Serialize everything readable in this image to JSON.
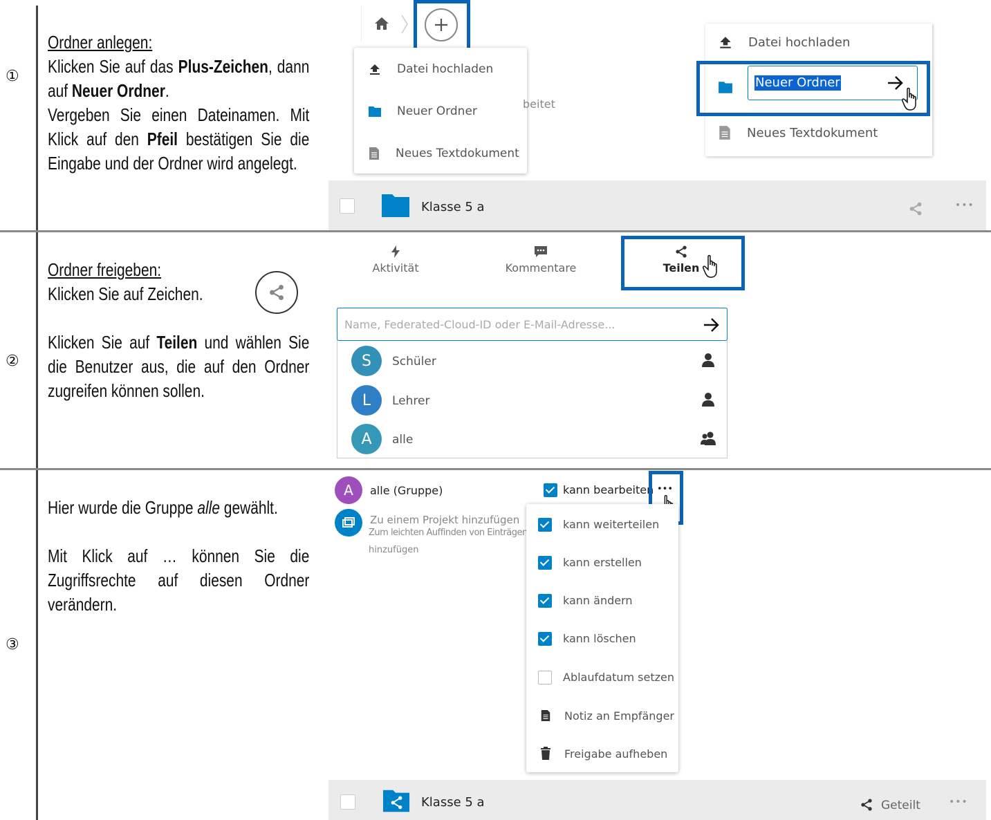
{
  "rows": [
    {
      "number": "①",
      "heading": "Ordner anlegen:",
      "text_parts": [
        {
          "t": "Klicken Sie auf das ",
          "b": false
        },
        {
          "t": "Plus-Zeichen",
          "b": true
        },
        {
          "t": ", dann auf ",
          "b": false
        },
        {
          "t": "Neuer Ordner",
          "b": true
        },
        {
          "t": ".",
          "b": false
        }
      ],
      "text2_parts": [
        {
          "t": "Vergeben Sie einen Dateinamen. Mit Klick auf den ",
          "b": false
        },
        {
          "t": "Pfeil",
          "b": true
        },
        {
          "t": " bestätigen Sie die Eingabe und der Ordner wird angelegt.",
          "b": false
        }
      ]
    },
    {
      "number": "②",
      "heading": "Ordner freigeben:",
      "line1": "Klicken Sie auf Zeichen.",
      "text_parts": [
        {
          "t": "Klicken Sie auf ",
          "b": false
        },
        {
          "t": "Teilen",
          "b": true
        },
        {
          "t": " und wählen Sie die Benutzer aus, die auf den Ordner zugreifen können sollen.",
          "b": false
        }
      ]
    },
    {
      "number": "③",
      "line1_parts": [
        {
          "t": "Hier wurde die Gruppe ",
          "i": false
        },
        {
          "t": "alle",
          "i": true
        },
        {
          "t": " gewählt.",
          "i": false
        }
      ],
      "text": "Mit Klick auf … können Sie die Zugriffsrechte auf diesen Ordner verändern."
    }
  ],
  "screen1": {
    "menu_left": {
      "items": [
        "Datei hochladen",
        "Neuer Ordner",
        "Neues Textdokument"
      ]
    },
    "partial_text": "beitet",
    "menu_right": {
      "upload": "Datei hochladen",
      "new_folder_input": "Neuer Ordner",
      "new_text": "Neues Textdokument"
    },
    "folder_row": {
      "name": "Klasse 5 a",
      "more": "•••"
    }
  },
  "screen2": {
    "tabs": [
      "Aktivität",
      "Kommentare",
      "Teilen"
    ],
    "search_placeholder": "Name, Federated-Cloud-ID oder E-Mail-Adresse...",
    "results": [
      {
        "initial": "S",
        "name": "Schüler",
        "color": "#3391b7"
      },
      {
        "initial": "L",
        "name": "Lehrer",
        "color": "#2f7fc4"
      },
      {
        "initial": "A",
        "name": "alle",
        "color": "#3598b6"
      }
    ]
  },
  "screen3": {
    "share_entry": {
      "initial": "A",
      "name": "alle (Gruppe)",
      "color": "#9e4fb9",
      "edit_label": "kann bearbeiten",
      "more": "•••"
    },
    "project": {
      "title": "Zu einem Projekt hinzufügen",
      "subtitle1": "Zum leichten Auffinden von Einträgen",
      "subtitle2": "hinzufügen"
    },
    "perm_menu": {
      "checked": [
        "kann weiterteilen",
        "kann erstellen",
        "kann ändern",
        "kann löschen"
      ],
      "unchecked": "Ablaufdatum setzen",
      "note": "Notiz an Empfänger",
      "unshare": "Freigabe aufheben"
    },
    "folder_row": {
      "name": "Klasse 5 a",
      "shared": "Geteilt",
      "more": "•••"
    }
  },
  "colors": {
    "nextcloud_blue": "#0082c9",
    "highlight_box": "#0b63b8",
    "bar_gray": "#ebebeb"
  }
}
